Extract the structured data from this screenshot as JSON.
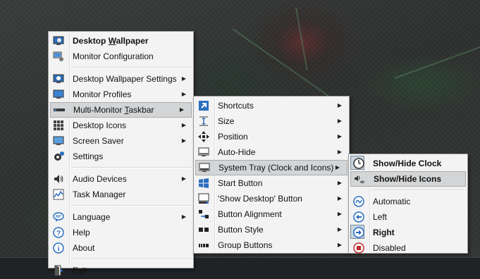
{
  "main_menu": {
    "items": [
      {
        "label_pre": "Desktop ",
        "label_u": "W",
        "label_post": "allpaper",
        "bold": true,
        "icon": "desktop-wallpaper-icon"
      },
      {
        "label_pre": "Monitor Configuration",
        "label_u": "",
        "label_post": "",
        "icon": "monitor-config-icon"
      },
      {
        "label_pre": "Desktop Wallpaper Settings",
        "label_u": "",
        "label_post": "",
        "icon": "wallpaper-settings-icon",
        "submenu": true
      },
      {
        "label_pre": "Monitor Profiles",
        "label_u": "",
        "label_post": "",
        "icon": "monitor-profiles-icon",
        "submenu": true
      },
      {
        "label_pre": "Multi-Monitor ",
        "label_u": "T",
        "label_post": "askbar",
        "icon": "taskbar-icon",
        "submenu": true,
        "highlighted": true
      },
      {
        "label_pre": "Desktop Icons",
        "label_u": "",
        "label_post": "",
        "icon": "desktop-icons-icon",
        "submenu": true
      },
      {
        "label_pre": "Screen Saver",
        "label_u": "",
        "label_post": "",
        "icon": "screen-saver-icon",
        "submenu": true
      },
      {
        "label_pre": "Settings",
        "label_u": "",
        "label_post": "",
        "icon": "gear-icon"
      },
      {
        "label_pre": "Audio Devices",
        "label_u": "",
        "label_post": "",
        "icon": "speaker-icon",
        "submenu": true
      },
      {
        "label_pre": "Task Manager",
        "label_u": "",
        "label_post": "",
        "icon": "task-manager-icon"
      },
      {
        "label_pre": "Language",
        "label_u": "",
        "label_post": "",
        "icon": "language-icon",
        "submenu": true
      },
      {
        "label_pre": "Help",
        "label_u": "",
        "label_post": "",
        "icon": "help-icon"
      },
      {
        "label_pre": "About",
        "label_u": "",
        "label_post": "",
        "icon": "info-icon"
      },
      {
        "label_pre": "E",
        "label_u": "x",
        "label_post": "it",
        "icon": "exit-icon"
      }
    ]
  },
  "taskbar_menu": {
    "items": [
      {
        "label": "Shortcuts",
        "icon": "shortcut-arrow-icon"
      },
      {
        "label": "Size",
        "icon": "size-icon"
      },
      {
        "label": "Position",
        "icon": "position-icon"
      },
      {
        "label": "Auto-Hide",
        "icon": "auto-hide-icon"
      },
      {
        "label": "System Tray (Clock and Icons)",
        "icon": "system-tray-icon",
        "highlighted": true
      },
      {
        "label": "Start Button",
        "icon": "windows-logo-icon"
      },
      {
        "label": "'Show Desktop' Button",
        "icon": "show-desktop-icon"
      },
      {
        "label": "Button Alignment",
        "icon": "button-alignment-icon"
      },
      {
        "label": "Button Style",
        "icon": "button-style-icon"
      },
      {
        "label": "Group Buttons",
        "icon": "group-buttons-icon"
      }
    ]
  },
  "tray_menu": {
    "items": [
      {
        "label": "Show/Hide Clock",
        "icon": "clock-icon",
        "bold": true,
        "checked": true
      },
      {
        "label": "Show/Hide Icons",
        "icon": "tray-icons-icon",
        "bold": true,
        "checked": true,
        "highlighted": true
      },
      {
        "label": "Automatic",
        "icon": "automatic-icon"
      },
      {
        "label": "Left",
        "icon": "left-arrow-icon"
      },
      {
        "label": "Right",
        "icon": "right-arrow-icon",
        "bold": true,
        "checked": true
      },
      {
        "label": "Disabled",
        "icon": "disabled-icon"
      }
    ]
  },
  "colors": {
    "accent_blue": "#2a6fc0",
    "highlight": "#d3d5d7",
    "disabled_red": "#c0282d"
  }
}
